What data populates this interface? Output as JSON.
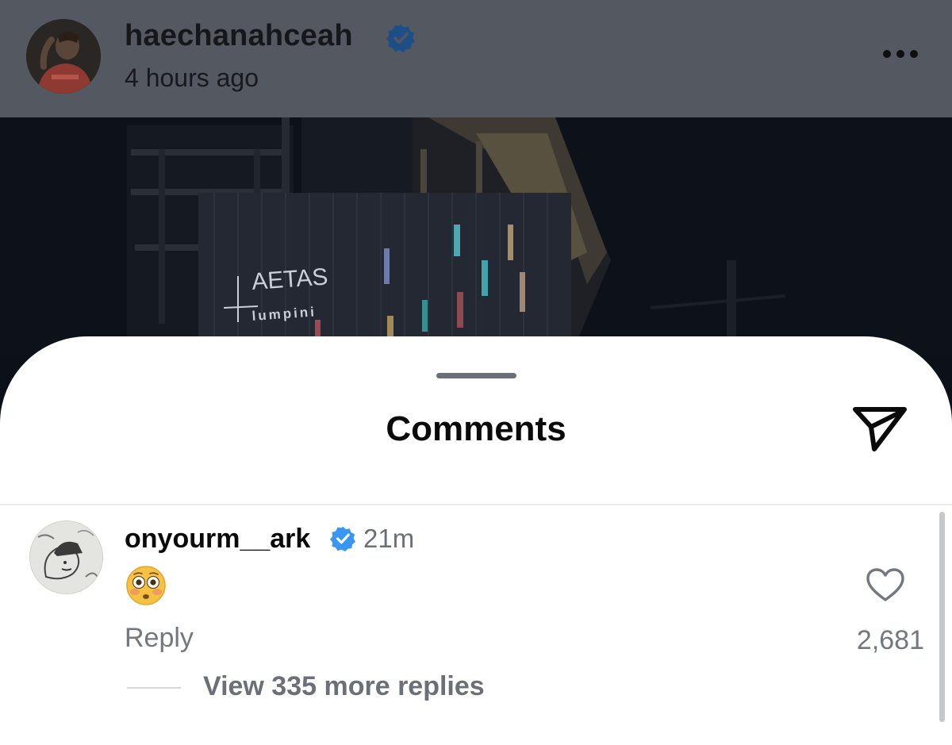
{
  "post": {
    "username": "haechanahceah",
    "time": "4 hours ago",
    "photo_sign": {
      "name": "AETAS",
      "subname": "lumpini"
    }
  },
  "comments_sheet": {
    "title": "Comments",
    "comment": {
      "username": "onyourm__ark",
      "time": "21m",
      "emoji": "flushed-face-emoji",
      "reply_label": "Reply",
      "likes": "2,681",
      "view_more_replies": "View 335 more replies"
    }
  },
  "colors": {
    "verified": "#3897f0",
    "overlay": "#545860",
    "secondary_text": "#73777e"
  }
}
